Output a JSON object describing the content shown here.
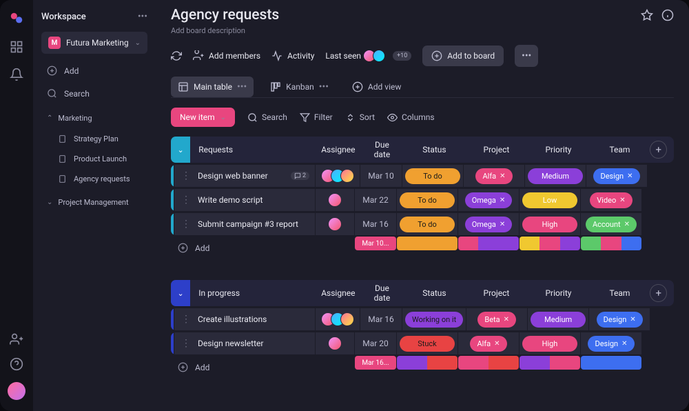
{
  "workspace": {
    "label": "Workspace",
    "badge_letter": "M",
    "name": "Futura Marketing",
    "add_label": "Add",
    "search_label": "Search"
  },
  "nav": {
    "sections": [
      {
        "label": "Marketing",
        "expanded": true,
        "items": [
          "Strategy Plan",
          "Product Launch",
          "Agency requests"
        ]
      },
      {
        "label": "Project Management",
        "expanded": false
      }
    ]
  },
  "board": {
    "title": "Agency requests",
    "description": "Add board description",
    "add_members": "Add members",
    "activity": "Activity",
    "last_seen": "Last seen",
    "seen_count": "+10",
    "add_to_board": "Add to board"
  },
  "views": {
    "main_table": "Main table",
    "kanban": "Kanban",
    "add_view": "Add view"
  },
  "controls": {
    "new_item": "New item",
    "search": "Search",
    "filter": "Filter",
    "sort": "Sort",
    "columns": "Columns"
  },
  "columns": {
    "name": "Requests",
    "assignee": "Assignee",
    "due": "Due date",
    "status": "Status",
    "project": "Project",
    "priority": "Priority",
    "team": "Team"
  },
  "columns2": {
    "name": "In progress",
    "assignee": "Assignee",
    "due": "Due date",
    "status": "Status",
    "project": "Project",
    "priority": "Priority",
    "team": "Team"
  },
  "group1": {
    "summary_due": "Mar 10...",
    "rows": [
      {
        "name": "Design web banner",
        "comments": "2",
        "due": "Mar 10",
        "status": {
          "t": "To do",
          "c": "#f0a030"
        },
        "project": {
          "t": "Alfa",
          "c": "#e8467f"
        },
        "priority": {
          "t": "Medium",
          "c": "#8b3fd9"
        },
        "team": {
          "t": "Design",
          "c": "#3d6ef0"
        }
      },
      {
        "name": "Write demo script",
        "due": "Mar 22",
        "status": {
          "t": "To do",
          "c": "#f0a030"
        },
        "project": {
          "t": "Omega",
          "c": "#8b3fd9"
        },
        "priority": {
          "t": "Low",
          "c": "#f0c830"
        },
        "team": {
          "t": "Video",
          "c": "#e8467f"
        }
      },
      {
        "name": "Submit campaign #3 report",
        "due": "Mar 16",
        "status": {
          "t": "To do",
          "c": "#f0a030"
        },
        "project": {
          "t": "Omega",
          "c": "#8b3fd9"
        },
        "priority": {
          "t": "High",
          "c": "#e8467f"
        },
        "team": {
          "t": "Account",
          "c": "#5cc96a"
        }
      }
    ]
  },
  "group2": {
    "summary_due": "Mar 16...",
    "rows": [
      {
        "name": "Create illustrations",
        "due": "Mar 16",
        "status": {
          "t": "Working on it",
          "c": "#8b3fd9"
        },
        "project": {
          "t": "Beta",
          "c": "#e8467f"
        },
        "priority": {
          "t": "Medium",
          "c": "#8b3fd9"
        },
        "team": {
          "t": "Design",
          "c": "#3d6ef0"
        }
      },
      {
        "name": "Design newsletter",
        "due": "Mar 20",
        "status": {
          "t": "Stuck",
          "c": "#e84343"
        },
        "project": {
          "t": "Alfa",
          "c": "#e8467f"
        },
        "priority": {
          "t": "High",
          "c": "#e8467f"
        },
        "team": {
          "t": "Design",
          "c": "#3d6ef0"
        }
      }
    ]
  },
  "add_label": "Add"
}
